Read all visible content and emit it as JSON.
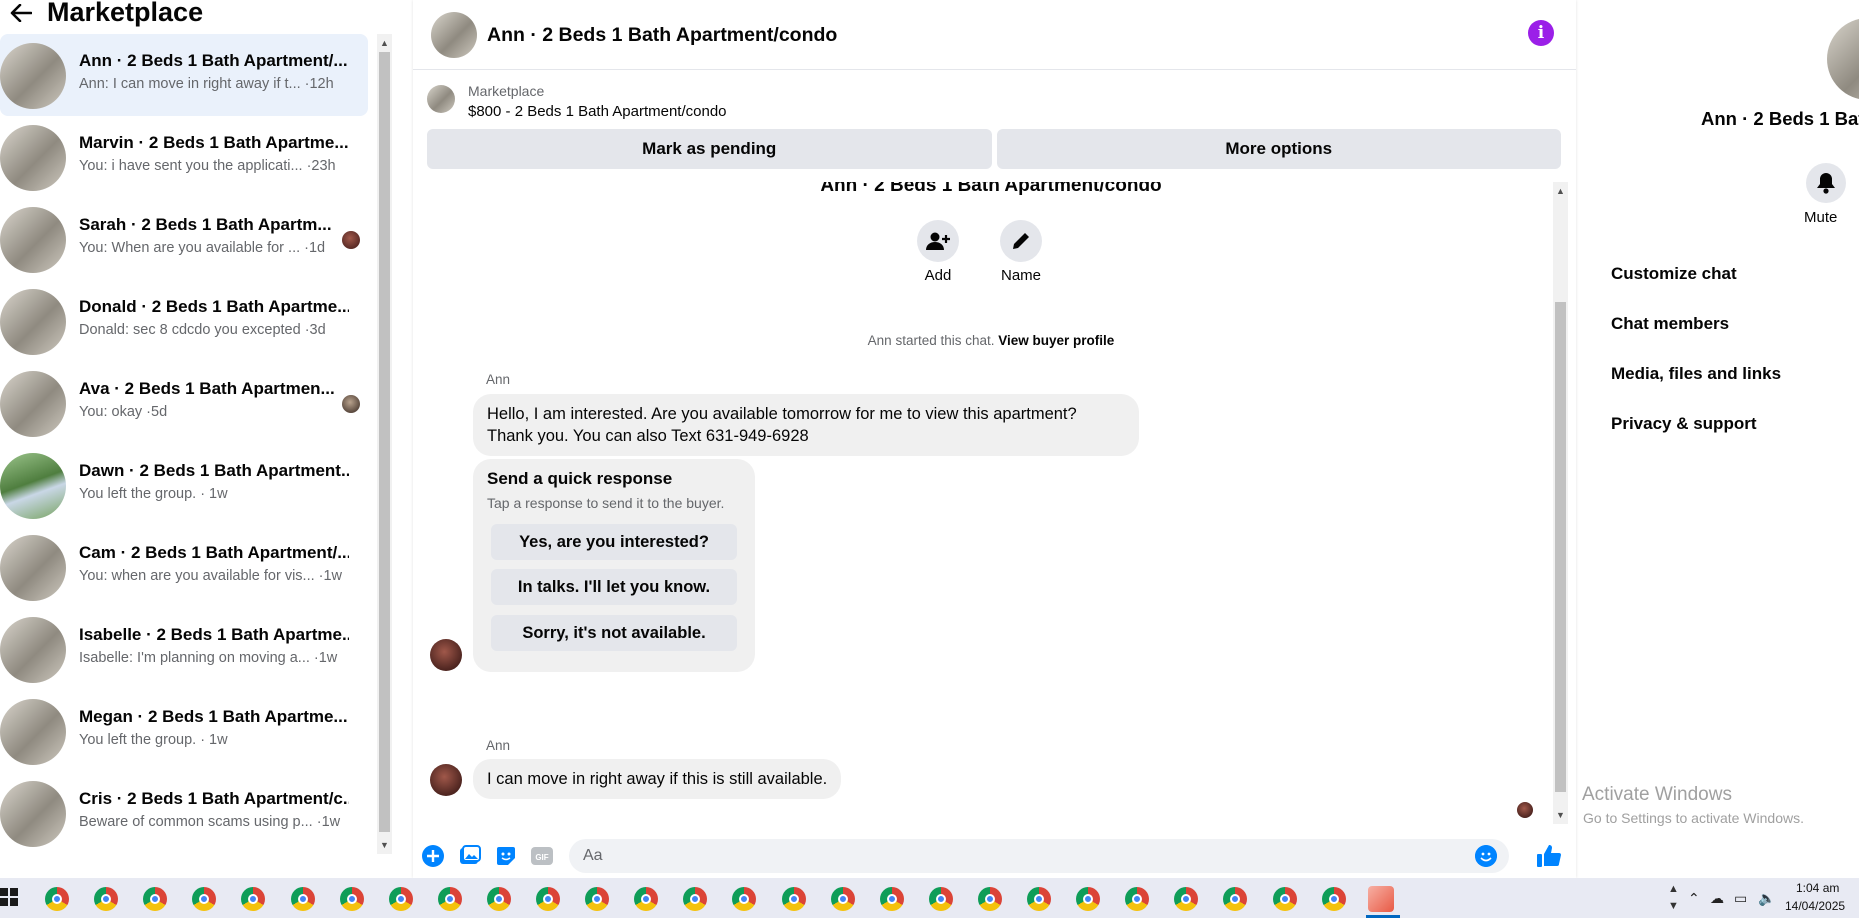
{
  "left": {
    "title": "Marketplace",
    "conversations": [
      {
        "name": "Ann · 2 Beds 1 Bath Apartment/...",
        "snippet": "Ann: I can move in right away if t... ·12h"
      },
      {
        "name": "Marvin · 2 Beds 1 Bath Apartme...",
        "snippet": "You: i have sent you the applicati... ·23h"
      },
      {
        "name": "Sarah · 2 Beds 1 Bath Apartm...",
        "snippet": "You: When are you available for ... ·1d"
      },
      {
        "name": "Donald · 2 Beds 1 Bath Apartme...",
        "snippet": "Donald: sec 8 cdcdo you excepted ·3d"
      },
      {
        "name": "Ava · 2 Beds 1 Bath Apartmen...",
        "snippet": "You: okay ·5d"
      },
      {
        "name": "Dawn · 2 Beds 1 Bath Apartment...",
        "snippet": "You left the group. · 1w"
      },
      {
        "name": "Cam · 2 Beds 1 Bath Apartment/...",
        "snippet": "You: when are you available for vis... ·1w"
      },
      {
        "name": "Isabelle · 2 Beds 1 Bath Apartme...",
        "snippet": "Isabelle: I'm planning on moving a... ·1w"
      },
      {
        "name": "Megan · 2 Beds 1 Bath Apartme...",
        "snippet": "You left the group. · 1w"
      },
      {
        "name": "Cris · 2 Beds 1 Bath Apartment/c...",
        "snippet": "Beware of common scams using p... ·1w"
      }
    ]
  },
  "chat": {
    "title": "Ann · 2 Beds 1 Bath Apartment/condo",
    "marketplace_label": "Marketplace",
    "listing": "$800 - 2 Beds 1 Bath Apartment/condo",
    "mark_pending": "Mark as pending",
    "more_options": "More options",
    "thread_title": "Ann · 2 Beds 1 Bath Apartment/condo",
    "add_label": "Add",
    "name_label": "Name",
    "started_text": "Ann started this chat.",
    "view_buyer": "View buyer profile",
    "sender": "Ann",
    "msg1_line1": "Hello, I am interested. Are you available tomorrow for me to view this apartment?",
    "msg1_line2": "Thank you. You can also Text 631-949-6928",
    "qr_title": "Send a quick response",
    "qr_sub": "Tap a response to send it to the buyer.",
    "qr_options": [
      "Yes, are you interested?",
      "In talks. I'll let you know.",
      "Sorry, it's not available."
    ],
    "msg2": "I can move in right away if this is still available.",
    "composer_placeholder": "Aa"
  },
  "right": {
    "name": "Ann · 2 Beds 1 Bat",
    "mute": "Mute",
    "menu": [
      "Customize chat",
      "Chat members",
      "Media, files and links",
      "Privacy & support"
    ]
  },
  "watermark": {
    "title": "Activate Windows",
    "sub": "Go to Settings to activate Windows."
  },
  "taskbar": {
    "time": "1:04 am",
    "date": "14/04/2025"
  },
  "colors": {
    "accent": "#0084ff",
    "info": "#9b1fe8",
    "active_row": "#eaf1fb"
  }
}
